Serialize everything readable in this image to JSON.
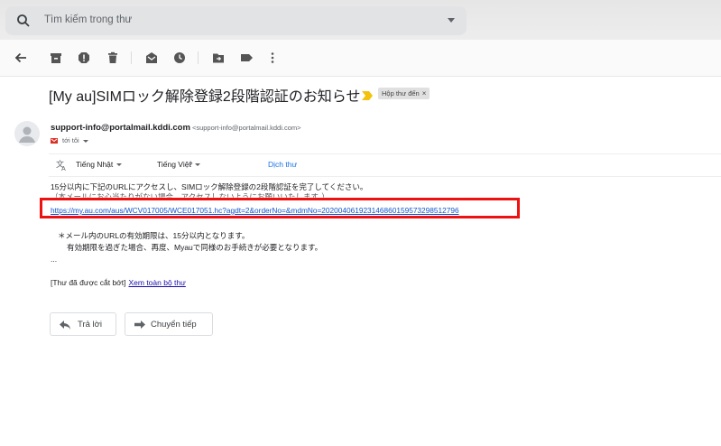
{
  "search": {
    "placeholder": "Tìm kiếm trong thư"
  },
  "email": {
    "subject": "[My au]SIMロック解除登録2段階認証のお知らせ",
    "label_chip": "Hộp thư đến",
    "label_chip_close": "×",
    "sender_name": "support-info@portalmail.kddi.com",
    "sender_address": "<support-info@portalmail.kddi.com>",
    "to_label": "tới tôi"
  },
  "translation": {
    "source_lang": "Tiếng Nhật",
    "arrow": "›",
    "target_lang": "Tiếng Việt",
    "translate_link": "Dịch thư"
  },
  "body": {
    "line1": "15分以内に下記のURLにアクセスし、SIMロック解除登録の2段階認証を完了してください。",
    "line2": "（本メールにお心当たりがない場合、アクセスしないようにお願いいたします。）",
    "url": "https://my.au.com/aus/WCV017005/WCE017051.hc?agdt=2&orderNo=&mdmNo=20200406192314686015957329851279​6",
    "note1": "＊メール内のURLの有効期限は、15分以内となります。",
    "note2": "有効期限を過ぎた場合、再度、Myauで同様のお手続きが必要となります。",
    "ellipsis": "...",
    "trimmed": "[Thư đã được cắt bớt]",
    "view_full": "Xem toàn bộ thư"
  },
  "actions": {
    "reply": "Trả lời",
    "forward": "Chuyển tiếp"
  },
  "colors": {
    "highlight_box": "#ee1111",
    "link": "#1155cc",
    "translate_link": "#1a73e8",
    "important_marker": "#f4c20d"
  },
  "icons": [
    "search-icon",
    "back-arrow-icon",
    "archive-icon",
    "report-spam-icon",
    "delete-icon",
    "mark-unread-icon",
    "snooze-icon",
    "move-to-icon",
    "label-icon",
    "more-vert-icon",
    "important-marker-icon",
    "avatar-icon",
    "translate-icon",
    "reply-icon",
    "forward-icon"
  ]
}
